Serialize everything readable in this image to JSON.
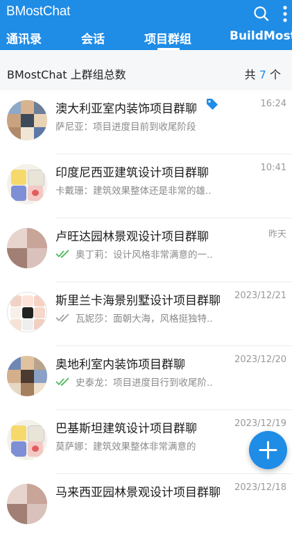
{
  "app": {
    "title": "BMostChat"
  },
  "tabs": [
    {
      "label": "通讯录"
    },
    {
      "label": "会话"
    },
    {
      "label": "项目群组"
    },
    {
      "label": "BuildMost"
    }
  ],
  "summary": {
    "label": "BMostChat 上群组总数",
    "prefix": "共",
    "count": "7",
    "suffix": "个"
  },
  "groups": [
    {
      "name": "澳大利亚室内装饰项目群聊",
      "time": "16:24",
      "preview": "萨尼亚：项目进度目前到收尾阶段",
      "tag_icon": "tag-icon",
      "check": "none"
    },
    {
      "name": "印度尼西亚建筑设计项目群聊",
      "time": "10:41",
      "preview": "卡戴珊：建筑效果整体还是非常的雄..",
      "check": "none"
    },
    {
      "name": "卢旺达园林景观设计项目群聊",
      "time": "昨天",
      "preview": "奥丁莉：设计风格非常满意的一..",
      "check": "read"
    },
    {
      "name": "斯里兰卡海景别墅设计项目群聊",
      "time": "2023/12/21",
      "preview": "瓦妮莎：面朝大海，风格挺独特..",
      "check": "delivered"
    },
    {
      "name": "奥地利室内装饰项目群聊",
      "time": "2023/12/20",
      "preview": "史泰龙：项目进度目行到收尾阶..",
      "check": "read"
    },
    {
      "name": "巴基斯坦建筑设计项目群聊",
      "time": "2023/12/19",
      "preview": "莫萨娜：建筑效果整体非常满意的",
      "check": "none"
    },
    {
      "name": "马来西亚园林景观设计项目群聊",
      "time": "2023/12/18",
      "preview": "",
      "check": "none"
    }
  ],
  "colors": {
    "accent": "#1f8ce6",
    "read_check": "#3bb54a",
    "delivered_check": "#9a9a9a"
  }
}
